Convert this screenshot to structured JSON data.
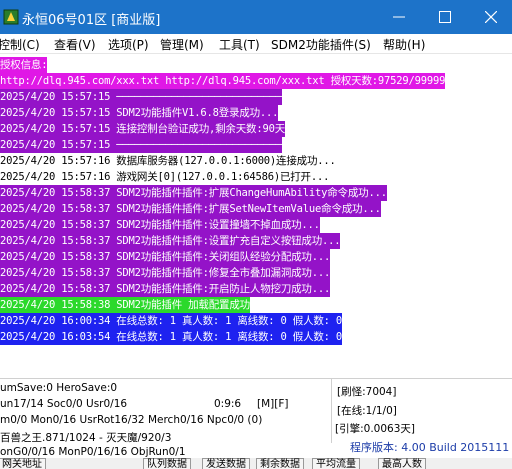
{
  "window": {
    "title": "永恒06号01区 [商业版]",
    "icon": "app-icon",
    "controls": [
      "minimize-icon",
      "maximize-icon",
      "close-icon"
    ]
  },
  "menu": {
    "items": [
      {
        "label": "控制(C)"
      },
      {
        "label": "查看(V)"
      },
      {
        "label": "选项(P)"
      },
      {
        "label": "管理(M)"
      },
      {
        "label": "工具(T)"
      },
      {
        "label": "SDM2功能插件(S)"
      },
      {
        "label": "帮助(H)"
      }
    ]
  },
  "colors": {
    "titlebar": "#1d73c9",
    "magenta": "#e018e6",
    "purple": "#9413c8",
    "green": "#2bd92b",
    "blue": "#1e22f0",
    "version": "#1c3ca8"
  },
  "log": {
    "lines": [
      {
        "text": "授权信息:",
        "color": "magenta"
      },
      {
        "text": "http://dlq.945.com/xxx.txt http://dlq.945.com/xxx.txt 授权天数:97529/99999",
        "color": "magenta"
      },
      {
        "text": "2025/4/20 15:57:15 ───────────────────────────",
        "color": "purple"
      },
      {
        "text": "2025/4/20 15:57:15 SDM2功能插件V1.6.8登录成功...",
        "color": "purple"
      },
      {
        "text": "2025/4/20 15:57:15 连接控制台验证成功,剩余天数:90天",
        "color": "purple"
      },
      {
        "text": "2025/4/20 15:57:15 ───────────────────────────",
        "color": "purple"
      },
      {
        "text": "2025/4/20 15:57:16 数据库服务器(127.0.0.1:6000)连接成功...",
        "color": "white"
      },
      {
        "text": "2025/4/20 15:57:16 游戏网关[0](127.0.0.1:64586)已打开...",
        "color": "white"
      },
      {
        "text": "2025/4/20 15:58:37 SDM2功能插件插件:扩展ChangeHumAbility命令成功...",
        "color": "purple"
      },
      {
        "text": "2025/4/20 15:58:37 SDM2功能插件插件:扩展SetNewItemValue命令成功...",
        "color": "purple"
      },
      {
        "text": "2025/4/20 15:58:37 SDM2功能插件插件:设置撞墙不掉血成功...",
        "color": "purple"
      },
      {
        "text": "2025/4/20 15:58:37 SDM2功能插件插件:设置扩充自定义按钮成功...",
        "color": "purple"
      },
      {
        "text": "2025/4/20 15:58:37 SDM2功能插件插件:关闭组队经验分配成功...",
        "color": "purple"
      },
      {
        "text": "2025/4/20 15:58:37 SDM2功能插件插件:修复全市叠加漏洞成功...",
        "color": "purple"
      },
      {
        "text": "2025/4/20 15:58:37 SDM2功能插件插件:开启防止人物挖刀成功...",
        "color": "purple"
      },
      {
        "text": "2025/4/20 15:58:38 SDM2功能插件 加载配置成功",
        "color": "green"
      },
      {
        "text": "2025/4/20 16:00:34 在线总数: 1 真人数: 1 离线数: 0 假人数: 0",
        "color": "blue"
      },
      {
        "text": "2025/4/20 16:03:54 在线总数: 1 真人数: 1 离线数: 0 假人数: 0",
        "color": "blue"
      }
    ]
  },
  "status": {
    "line1": "umSave:0 HeroSave:0",
    "line2": "un17/14 Soc0/0 Usr0/16",
    "time": "0:9:6",
    "mode": "[M][F]",
    "line3": "m0/0 Mon0/16 UsrRot16/32 Merch0/16 Npc0/0 (0)",
    "line4": "百兽之王.871/1024 - 灭天魔/920/3",
    "line5": "onG0/0/16 MonP0/16/16 ObjRun0/1",
    "refresh": "[刷怪:7004]",
    "online": "[在线:1/1/0]",
    "engine": "[引擎:0.0063天]",
    "version": "程序版本: 4.00 Build 2015111"
  },
  "tabs": [
    {
      "label": "网关地址"
    },
    {
      "label": "队列数据"
    },
    {
      "label": "发送数据"
    },
    {
      "label": "剩余数据"
    },
    {
      "label": "平均流量"
    },
    {
      "label": "最高人数"
    }
  ]
}
